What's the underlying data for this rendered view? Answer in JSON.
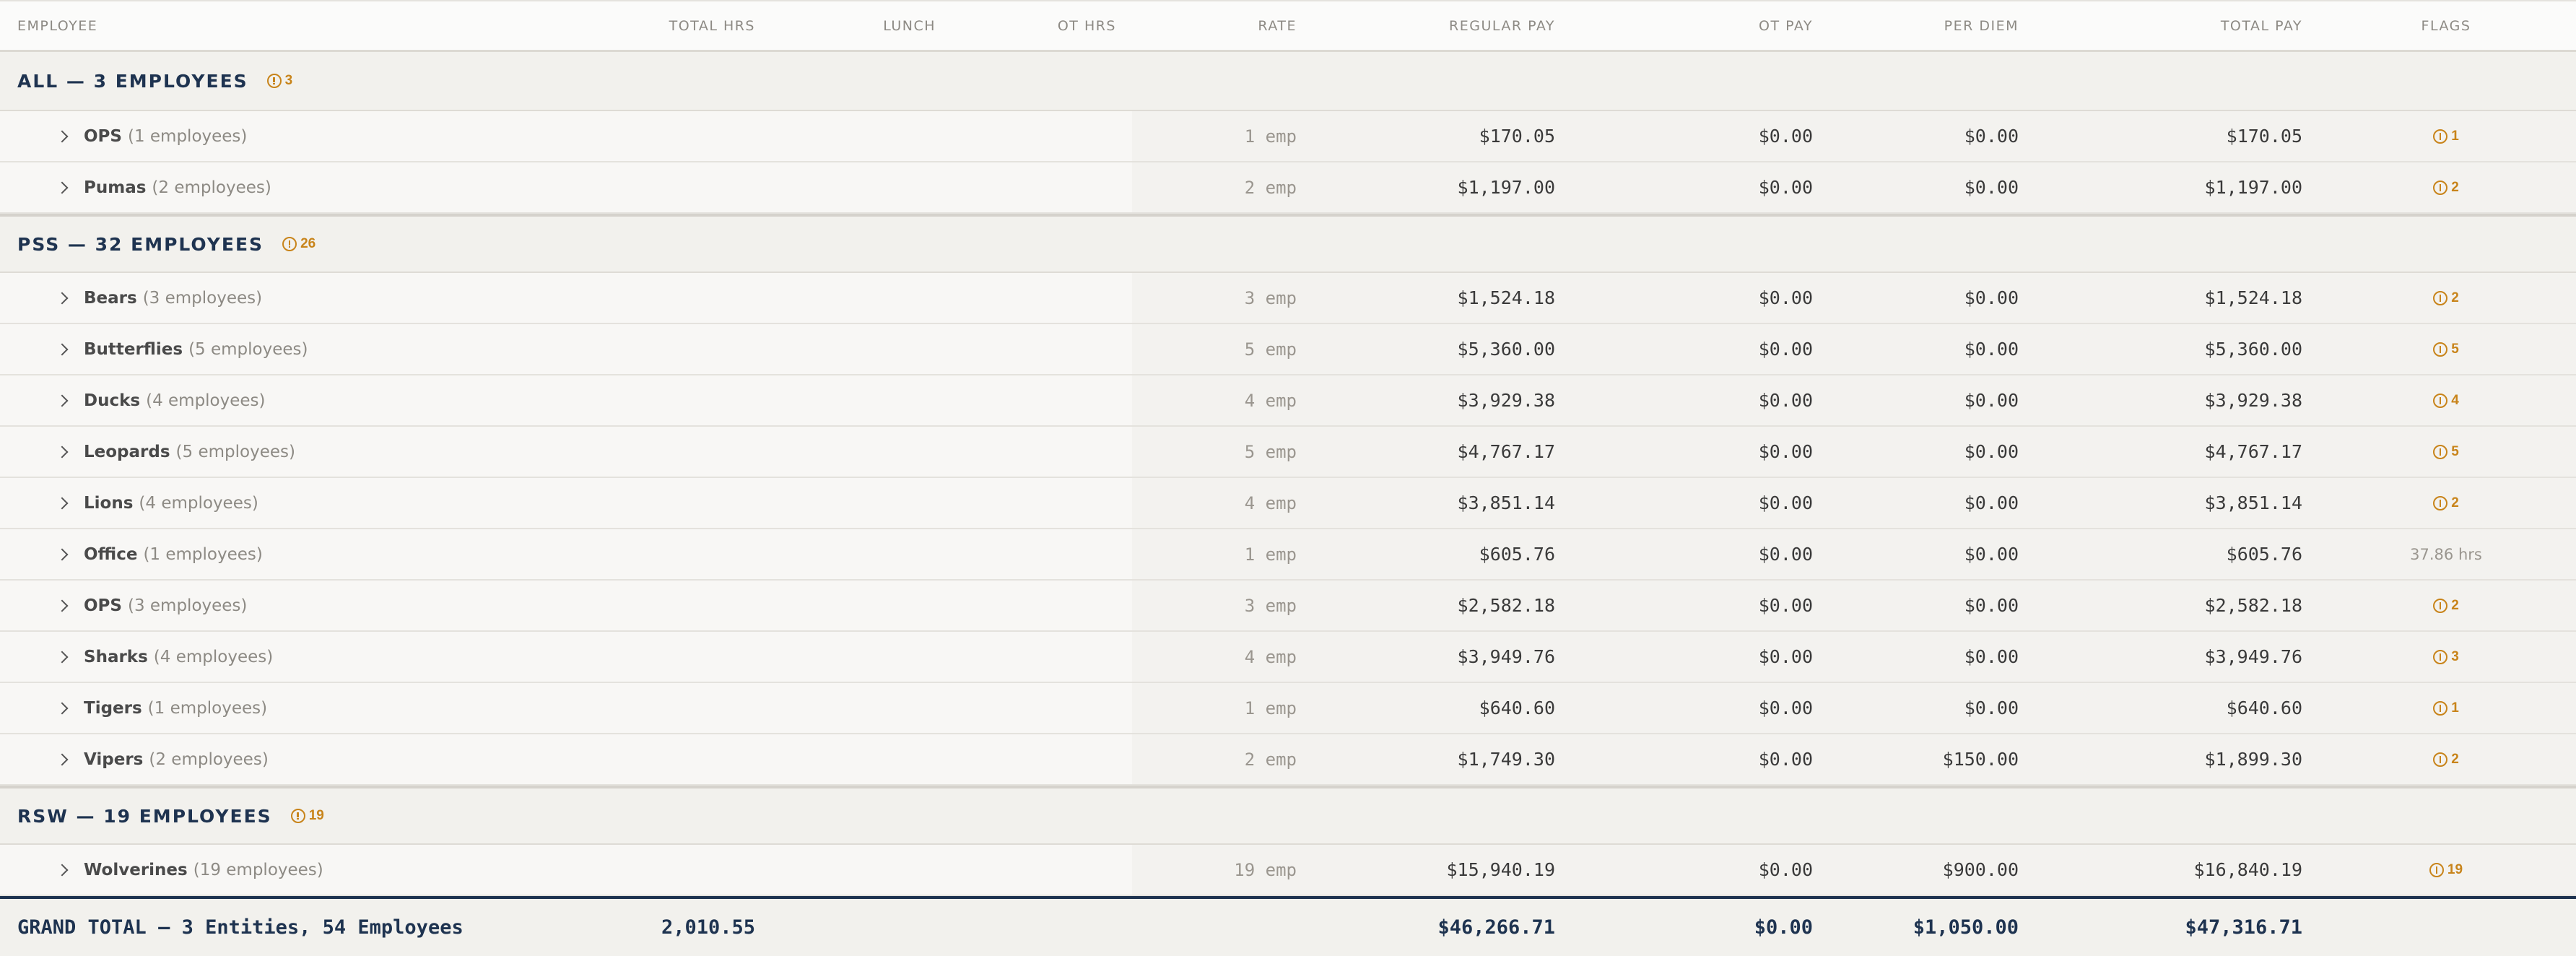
{
  "columns": {
    "employee": "EMPLOYEE",
    "total_hrs": "TOTAL HRS",
    "lunch": "LUNCH",
    "ot_hrs": "OT HRS",
    "rate": "RATE",
    "regular_pay": "REGULAR PAY",
    "ot_pay": "OT PAY",
    "per_diem": "PER DIEM",
    "total_pay": "TOTAL PAY",
    "flags": "FLAGS"
  },
  "groups": [
    {
      "title": "ALL — 3 EMPLOYEES",
      "flags": "3",
      "teams": [
        {
          "name": "OPS",
          "count": "(1 employees)",
          "rate": "1 emp",
          "regular_pay": "$170.05",
          "ot_pay": "$0.00",
          "per_diem": "$0.00",
          "total_pay": "$170.05",
          "flags": "1"
        },
        {
          "name": "Pumas",
          "count": "(2 employees)",
          "rate": "2 emp",
          "regular_pay": "$1,197.00",
          "ot_pay": "$0.00",
          "per_diem": "$0.00",
          "total_pay": "$1,197.00",
          "flags": "2"
        }
      ]
    },
    {
      "title": "PSS — 32 EMPLOYEES",
      "flags": "26",
      "teams": [
        {
          "name": "Bears",
          "count": "(3 employees)",
          "rate": "3 emp",
          "regular_pay": "$1,524.18",
          "ot_pay": "$0.00",
          "per_diem": "$0.00",
          "total_pay": "$1,524.18",
          "flags": "2"
        },
        {
          "name": "Butterflies",
          "count": "(5 employees)",
          "rate": "5 emp",
          "regular_pay": "$5,360.00",
          "ot_pay": "$0.00",
          "per_diem": "$0.00",
          "total_pay": "$5,360.00",
          "flags": "5"
        },
        {
          "name": "Ducks",
          "count": "(4 employees)",
          "rate": "4 emp",
          "regular_pay": "$3,929.38",
          "ot_pay": "$0.00",
          "per_diem": "$0.00",
          "total_pay": "$3,929.38",
          "flags": "4"
        },
        {
          "name": "Leopards",
          "count": "(5 employees)",
          "rate": "5 emp",
          "regular_pay": "$4,767.17",
          "ot_pay": "$0.00",
          "per_diem": "$0.00",
          "total_pay": "$4,767.17",
          "flags": "5"
        },
        {
          "name": "Lions",
          "count": "(4 employees)",
          "rate": "4 emp",
          "regular_pay": "$3,851.14",
          "ot_pay": "$0.00",
          "per_diem": "$0.00",
          "total_pay": "$3,851.14",
          "flags": "2"
        },
        {
          "name": "Office",
          "count": "(1 employees)",
          "rate": "1 emp",
          "regular_pay": "$605.76",
          "ot_pay": "$0.00",
          "per_diem": "$0.00",
          "total_pay": "$605.76",
          "flags": "",
          "hrs_note": "37.86 hrs"
        },
        {
          "name": "OPS",
          "count": "(3 employees)",
          "rate": "3 emp",
          "regular_pay": "$2,582.18",
          "ot_pay": "$0.00",
          "per_diem": "$0.00",
          "total_pay": "$2,582.18",
          "flags": "2"
        },
        {
          "name": "Sharks",
          "count": "(4 employees)",
          "rate": "4 emp",
          "regular_pay": "$3,949.76",
          "ot_pay": "$0.00",
          "per_diem": "$0.00",
          "total_pay": "$3,949.76",
          "flags": "3"
        },
        {
          "name": "Tigers",
          "count": "(1 employees)",
          "rate": "1 emp",
          "regular_pay": "$640.60",
          "ot_pay": "$0.00",
          "per_diem": "$0.00",
          "total_pay": "$640.60",
          "flags": "1"
        },
        {
          "name": "Vipers",
          "count": "(2 employees)",
          "rate": "2 emp",
          "regular_pay": "$1,749.30",
          "ot_pay": "$0.00",
          "per_diem": "$150.00",
          "total_pay": "$1,899.30",
          "flags": "2"
        }
      ]
    },
    {
      "title": "RSW — 19 EMPLOYEES",
      "flags": "19",
      "teams": [
        {
          "name": "Wolverines",
          "count": "(19 employees)",
          "rate": "19 emp",
          "regular_pay": "$15,940.19",
          "ot_pay": "$0.00",
          "per_diem": "$900.00",
          "total_pay": "$16,840.19",
          "flags": "19"
        }
      ]
    }
  ],
  "grand_total": {
    "label": "GRAND TOTAL — 3 Entities, 54 Employees",
    "total_hrs": "2,010.55",
    "regular_pay": "$46,266.71",
    "ot_pay": "$0.00",
    "per_diem": "$1,050.00",
    "total_pay": "$47,316.71"
  },
  "colors": {
    "accent_navy": "#1e3350",
    "flag_orange": "#c8841a",
    "row_bg": "#f8f7f5",
    "group_bg": "#f2f1ed"
  }
}
